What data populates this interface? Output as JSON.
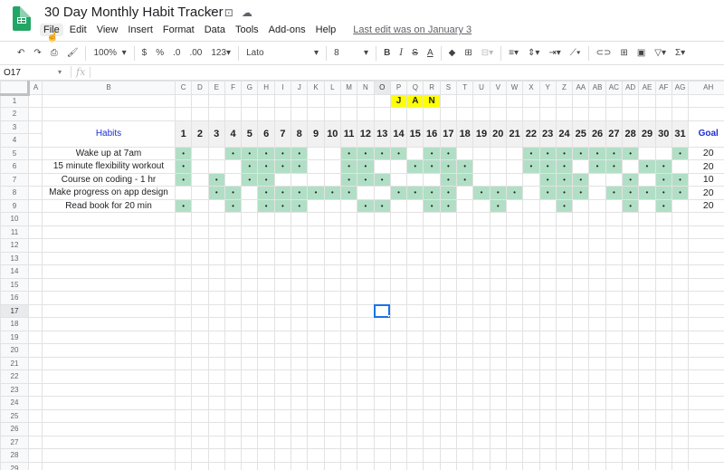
{
  "app": {
    "title": "30 Day Monthly Habit Tracker",
    "icons": [
      "star-icon",
      "move-to-folder-icon",
      "cloud-saved-icon"
    ]
  },
  "menu": {
    "items": [
      "File",
      "Edit",
      "View",
      "Insert",
      "Format",
      "Data",
      "Tools",
      "Add-ons",
      "Help"
    ],
    "last_edit": "Last edit was on January 3"
  },
  "toolbar": {
    "zoom": "100%",
    "currency": "$",
    "percent": "%",
    "decrease_decimal": ".0",
    "increase_decimal": ".00",
    "more_formats": "123",
    "font": "Lato",
    "font_size": "8",
    "bold": "B",
    "italic": "I",
    "strike": "S",
    "text_color": "A"
  },
  "formula_bar": {
    "name_box": "O17",
    "fx": "fx",
    "value": ""
  },
  "columns": [
    "A",
    "B",
    "C",
    "D",
    "E",
    "F",
    "G",
    "H",
    "I",
    "J",
    "K",
    "L",
    "M",
    "N",
    "O",
    "P",
    "Q",
    "R",
    "S",
    "T",
    "U",
    "V",
    "W",
    "X",
    "Y",
    "Z",
    "AA",
    "AB",
    "AC",
    "AD",
    "AE",
    "AF",
    "AG",
    "AH"
  ],
  "selected_column": "O",
  "selected_row": 17,
  "month_label": [
    "J",
    "A",
    "N"
  ],
  "header": {
    "habits_label": "Habits",
    "goal_label": "Goal",
    "days": [
      1,
      2,
      3,
      4,
      5,
      6,
      7,
      8,
      9,
      10,
      11,
      12,
      13,
      14,
      15,
      16,
      17,
      18,
      19,
      20,
      21,
      22,
      23,
      24,
      25,
      26,
      27,
      28,
      29,
      30,
      31
    ]
  },
  "habits": [
    {
      "name": "Wake up at 7am",
      "goal": "20",
      "done": [
        1,
        4,
        5,
        6,
        7,
        8,
        11,
        12,
        13,
        14,
        16,
        17,
        22,
        23,
        24,
        25,
        26,
        27,
        28,
        31
      ]
    },
    {
      "name": "15 minute flexibility workout",
      "goal": "20",
      "done": [
        1,
        5,
        6,
        7,
        8,
        11,
        12,
        15,
        16,
        17,
        18,
        22,
        23,
        24,
        26,
        27,
        29,
        30
      ]
    },
    {
      "name": "Course on coding - 1 hr",
      "goal": "10",
      "done": [
        1,
        3,
        5,
        6,
        11,
        12,
        13,
        17,
        18,
        23,
        24,
        25,
        28,
        30,
        31
      ]
    },
    {
      "name": "Make progress on app design",
      "goal": "20",
      "done": [
        3,
        4,
        6,
        7,
        8,
        9,
        10,
        11,
        14,
        15,
        16,
        17,
        19,
        20,
        21,
        23,
        24,
        25,
        27,
        28,
        29,
        30,
        31
      ]
    },
    {
      "name": "Read book for 20 min",
      "goal": "20",
      "done": [
        1,
        4,
        6,
        7,
        8,
        12,
        13,
        16,
        17,
        20,
        24,
        28,
        30
      ]
    }
  ],
  "done_marker": "•",
  "total_rows": 29,
  "colors": {
    "done": "#b1dfc6",
    "month_highlight": "#ffff00",
    "header_accent": "#1f2ed9",
    "selection": "#1a73e8"
  }
}
